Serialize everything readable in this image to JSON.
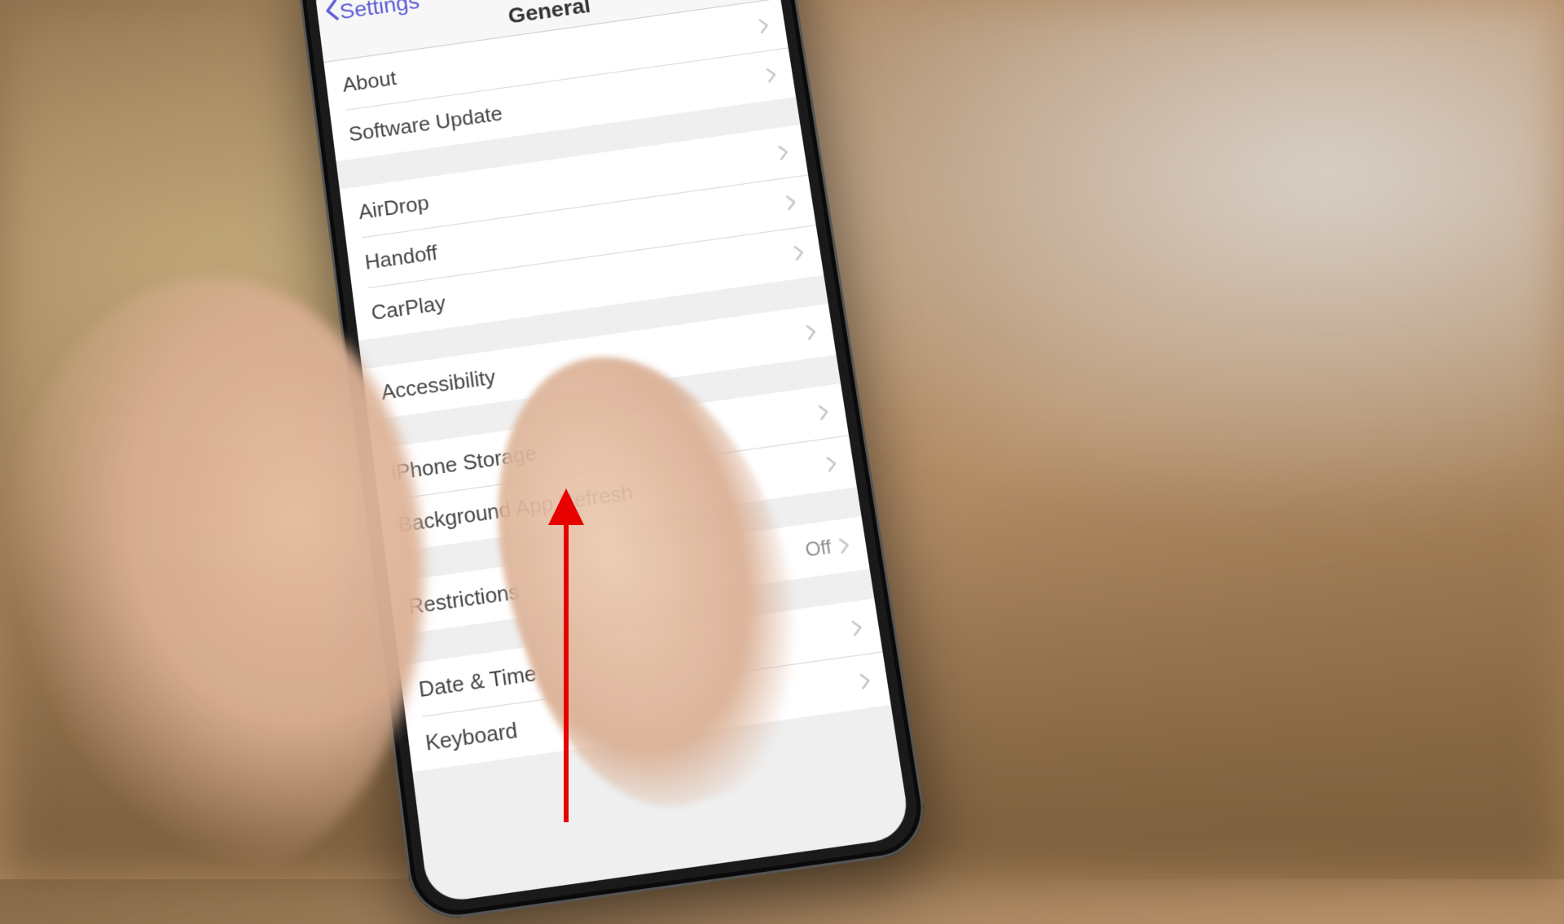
{
  "nav": {
    "back_label": "Settings",
    "title": "General"
  },
  "groups": [
    {
      "rows": [
        {
          "label": "About",
          "value": null
        },
        {
          "label": "Software Update",
          "value": null
        }
      ]
    },
    {
      "rows": [
        {
          "label": "AirDrop",
          "value": null
        },
        {
          "label": "Handoff",
          "value": null
        },
        {
          "label": "CarPlay",
          "value": null
        }
      ]
    },
    {
      "rows": [
        {
          "label": "Accessibility",
          "value": null
        }
      ]
    },
    {
      "rows": [
        {
          "label": "iPhone Storage",
          "value": null
        },
        {
          "label": "Background App Refresh",
          "value": null
        }
      ]
    },
    {
      "rows": [
        {
          "label": "Restrictions",
          "value": "Off"
        }
      ]
    },
    {
      "rows": [
        {
          "label": "Date & Time",
          "value": null
        },
        {
          "label": "Keyboard",
          "value": null
        }
      ]
    }
  ],
  "annotation": {
    "type": "arrow",
    "direction": "up",
    "color": "#e60000"
  }
}
